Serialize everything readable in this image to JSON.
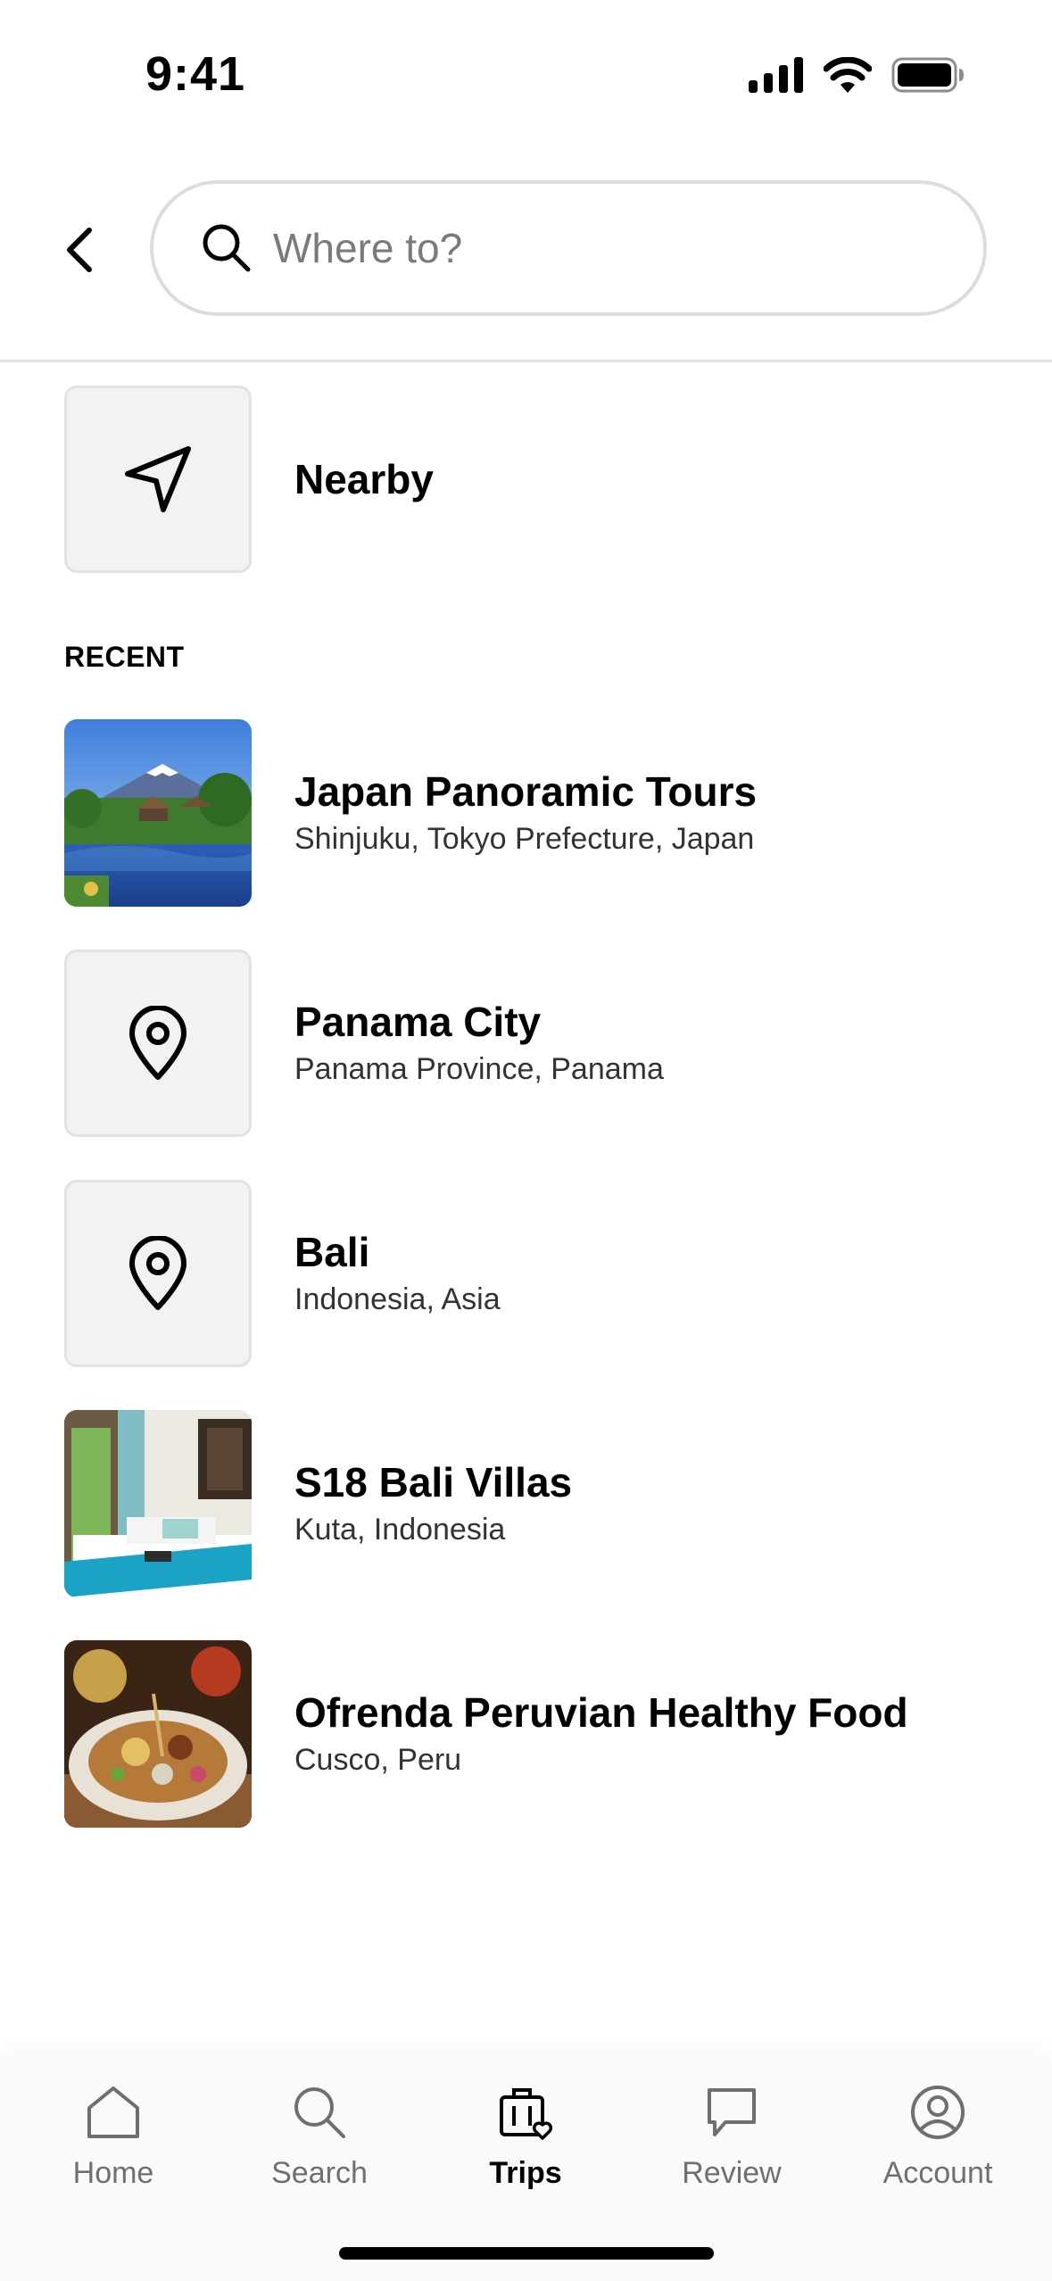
{
  "status_bar": {
    "time": "9:41"
  },
  "search": {
    "placeholder": "Where to?"
  },
  "nearby": {
    "label": "Nearby"
  },
  "recent": {
    "heading": "RECENT",
    "items": [
      {
        "title": "Japan Panoramic Tours",
        "subtitle": "Shinjuku, Tokyo Prefecture, Japan",
        "thumb": "photo-mountain-lake"
      },
      {
        "title": "Panama City",
        "subtitle": "Panama Province, Panama",
        "thumb": "location-pin-icon"
      },
      {
        "title": "Bali",
        "subtitle": "Indonesia, Asia",
        "thumb": "location-pin-icon"
      },
      {
        "title": "S18 Bali Villas",
        "subtitle": "Kuta, Indonesia",
        "thumb": "photo-villa-bedroom"
      },
      {
        "title": "Ofrenda Peruvian Healthy Food",
        "subtitle": "Cusco, Peru",
        "thumb": "photo-food-plate"
      }
    ]
  },
  "nav": {
    "items": [
      {
        "label": "Home",
        "icon": "home-icon",
        "active": false
      },
      {
        "label": "Search",
        "icon": "search-icon",
        "active": false
      },
      {
        "label": "Trips",
        "icon": "trips-icon",
        "active": true
      },
      {
        "label": "Review",
        "icon": "review-icon",
        "active": false
      },
      {
        "label": "Account",
        "icon": "account-icon",
        "active": false
      }
    ]
  },
  "colors": {
    "background": "#ffffff",
    "text": "#000000",
    "muted": "#6f6f6f",
    "tile": "#f2f2f2"
  }
}
